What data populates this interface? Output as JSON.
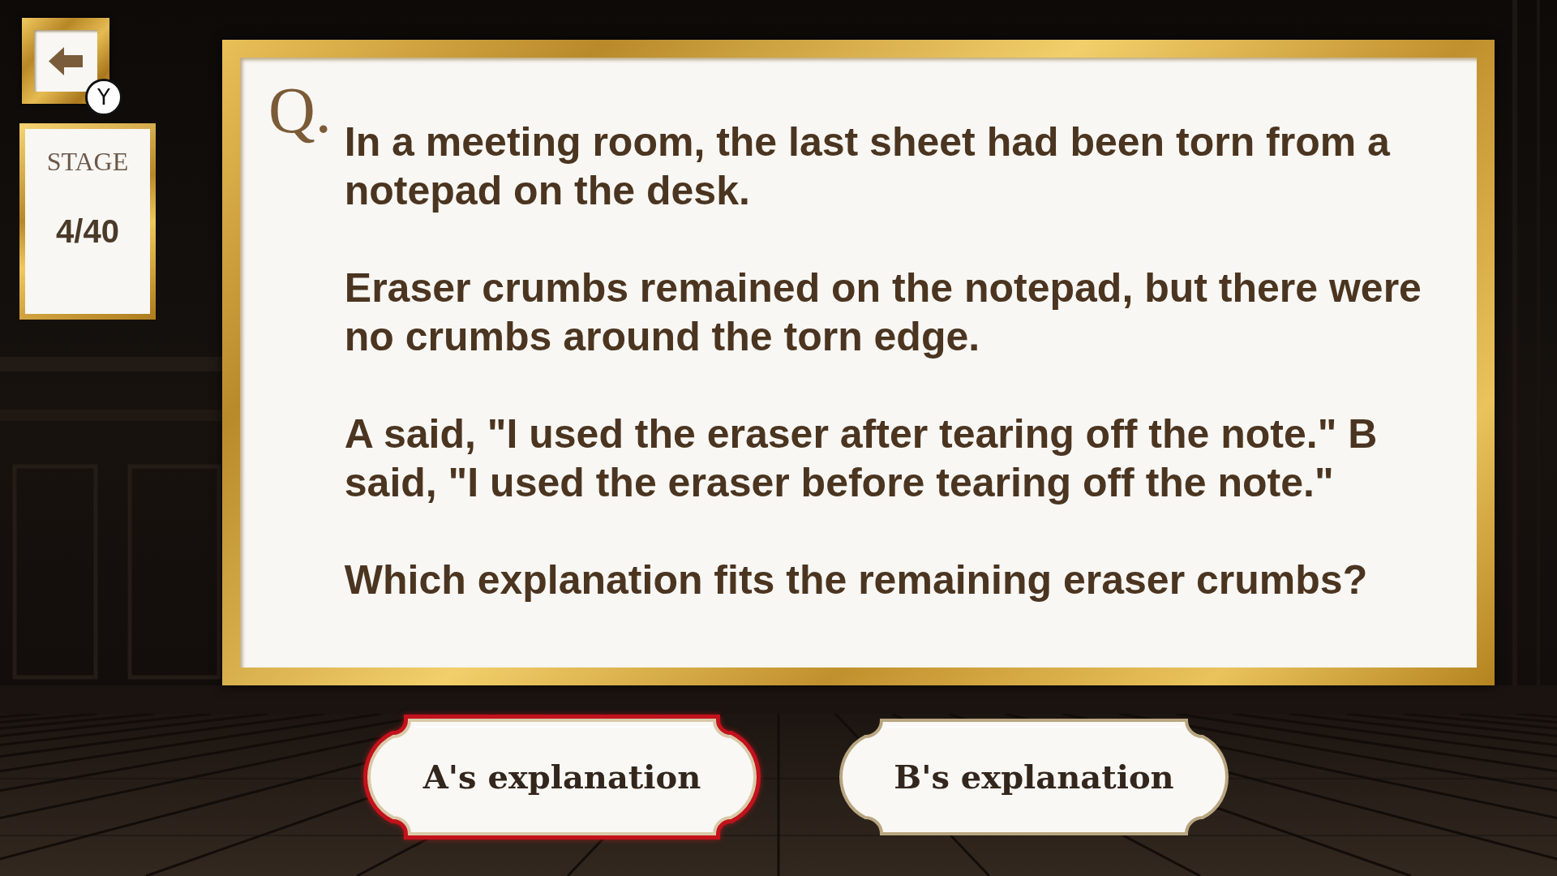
{
  "back_button": {
    "key_hint": "Y"
  },
  "stage": {
    "label": "STAGE",
    "counter": "4/40"
  },
  "question": {
    "marker": "Q.",
    "paragraphs": [
      "In a meeting room, the last sheet had been torn from a notepad on the desk.",
      "Eraser crumbs remained on the notepad, but there were no crumbs around the torn edge.",
      "A said, \"I used the eraser after tearing off the note.\" B said, \"I used the eraser before tearing off the note.\"",
      "Which explanation fits the remaining eraser crumbs?"
    ]
  },
  "answers": [
    {
      "label": "A's explanation",
      "selected": true
    },
    {
      "label": "B's explanation",
      "selected": false
    }
  ]
}
